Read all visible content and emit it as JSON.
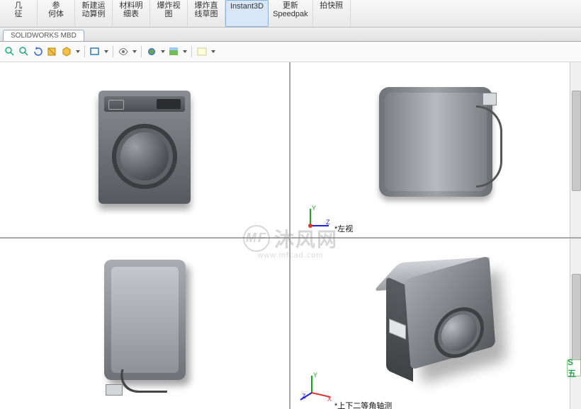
{
  "ribbon": [
    {
      "l1": "几",
      "l2": "征",
      "name": "feature"
    },
    {
      "l1": "参",
      "l2": "何体",
      "name": "reference-geometry"
    },
    {
      "l1": "新建运",
      "l2": "动算例",
      "name": "motion-study"
    },
    {
      "l1": "材料明",
      "l2": "细表",
      "name": "bom"
    },
    {
      "l1": "爆炸视",
      "l2": "图",
      "name": "exploded-view"
    },
    {
      "l1": "爆炸直",
      "l2": "线草图",
      "name": "explode-sketch"
    },
    {
      "l1": "Instant3D",
      "l2": "",
      "name": "instant3d",
      "active": true
    },
    {
      "l1": "更新",
      "l2": "Speedpak",
      "name": "speedpak"
    },
    {
      "l1": "拍快照",
      "l2": "",
      "name": "snapshot"
    }
  ],
  "tab": {
    "label": "SOLIDWORKS MBD"
  },
  "views": {
    "tr_label": "*左视",
    "br_label": "*上下二等角轴测"
  },
  "watermark": {
    "badge": "MF",
    "text": "沐风网",
    "sub": "www.mfcad.com"
  },
  "sogou": "S 五"
}
